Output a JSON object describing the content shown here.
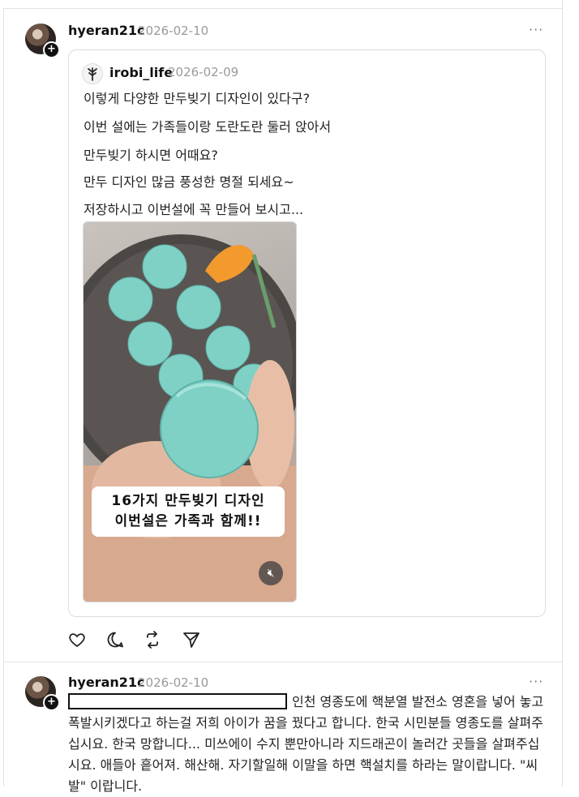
{
  "post": {
    "username": "hyeran21c",
    "date": "2026-02-10",
    "more": "···"
  },
  "quoted": {
    "username": "irobi_life",
    "date": "2026-02-09",
    "lines": [
      "이렇게 다양한 만두빚기 디자인이 있다구?",
      "이번 설에는 가족들이랑 도란도란 둘러 앉아서",
      "만두빚기 하시면 어때요?",
      "만두 디자인 많금 풍성한 명절 되세요~",
      "저장하시고 이번설에 꼭 만들어 보시고..."
    ],
    "video": {
      "caption_line1": "16가지 만두빚기 디자인",
      "caption_line2": "이번설은 가족과 함께!!",
      "mute_icon": "speaker-muted-icon"
    }
  },
  "actions": [
    "heart-icon",
    "comment-icon",
    "repost-icon",
    "share-icon"
  ],
  "reply": {
    "username": "hyeran21c",
    "date": "2026-02-10",
    "more": "···",
    "text": "인천 영종도에 핵분열 발전소 영혼을 넣어 놓고 폭발시키겠다고 하는걸 저희 아이가 꿈을 꿨다고 합니다. 한국 시민분들 영종도를 살펴주십시요. 한국 망합니다... 미쓰에이 수지 뿐만아니라 지드래곤이 놀러간 곳들을 살펴주십시요. 애들아 흩어져. 해산해. 자기할일해 이말을 하면 핵설치를 하라는 말이랍니다. \"씨발\" 이랍니다."
  }
}
